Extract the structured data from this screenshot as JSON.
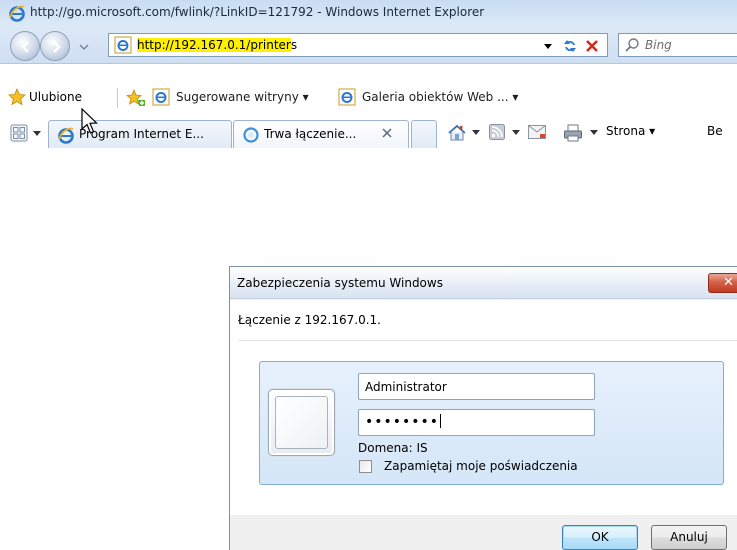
{
  "window": {
    "title": "http://go.microsoft.com/fwlink/?LinkID=121792 - Windows Internet Explorer"
  },
  "navbar": {
    "address_url_highlighted": "http://192.167.0.1/printer",
    "address_url_rest": "s",
    "search_placeholder": "Bing"
  },
  "favorites_bar": {
    "favorites_label": "Ulubione",
    "suggested_sites_label": "Sugerowane witryny ▾",
    "web_slice_gallery_label": "Galeria obiektów Web ... ▾"
  },
  "tabs": [
    {
      "label": "Program Internet E..."
    },
    {
      "label": "Trwa łączenie..."
    }
  ],
  "command_bar": {
    "page_label": "Strona ▾",
    "safety_label": "Be"
  },
  "dialog": {
    "title": "Zabezpieczenia systemu Windows",
    "subtitle": "Łączenie z 192.167.0.1.",
    "username_value": "Administrator",
    "password_masked": "••••••••",
    "domain_label": "Domena: IS",
    "remember_label": "Zapamiętaj moje poświadczenia",
    "remember_checked": false,
    "ok_label": "OK",
    "cancel_label": "Anuluj"
  },
  "colors": {
    "address_highlight": "#fff000",
    "dialog_close": "#c94a32",
    "credential_tile": "#dceafa"
  }
}
